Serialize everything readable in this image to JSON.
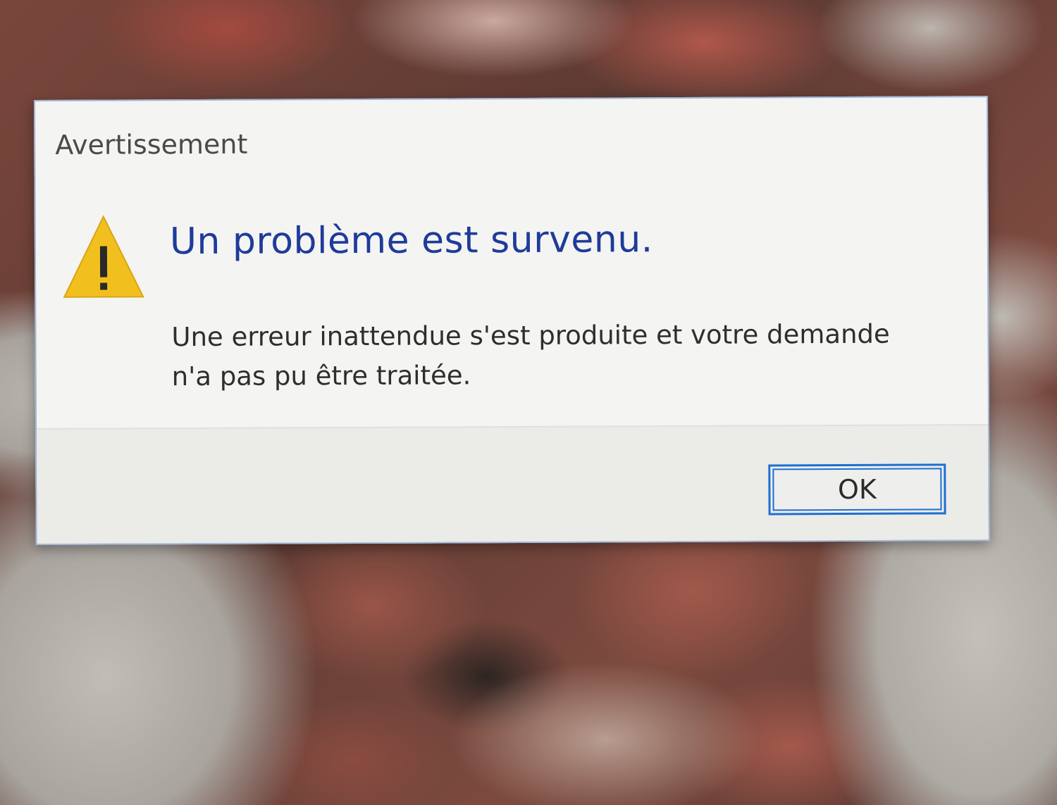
{
  "dialog": {
    "title": "Avertissement",
    "icon": "warning-triangle-icon",
    "main_instruction": "Un problème est survenu.",
    "content_lines": [
      "Une erreur inattendue s'est produite et votre demande",
      "n'a pas pu être traitée."
    ],
    "ok_button_label": "OK"
  },
  "colors": {
    "main_instruction": "#1f3b9a",
    "warning_icon_fill": "#f2c01e",
    "button_focus_border": "#1d6fd1"
  }
}
